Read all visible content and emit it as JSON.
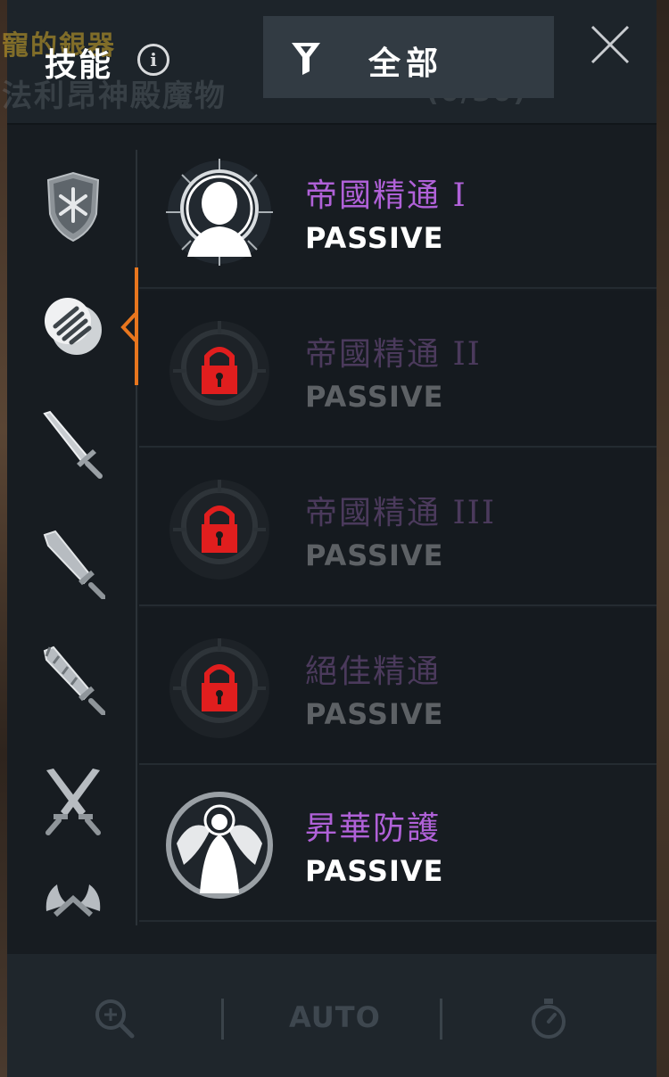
{
  "header": {
    "title": "技能",
    "info_icon": "info-icon",
    "filter_label": "全部",
    "filter_icon": "filter-icon",
    "close_icon": "close-icon",
    "background_ghost_text": [
      "寵的銀器",
      "法利昂神殿魔物",
      "(0/30)"
    ]
  },
  "sidebar": {
    "active_index": 1,
    "items": [
      {
        "icon": "shield-icon"
      },
      {
        "icon": "passive-orb-icon"
      },
      {
        "icon": "sword-icon"
      },
      {
        "icon": "broadsword-icon"
      },
      {
        "icon": "serrated-sword-icon"
      },
      {
        "icon": "crossed-swords-icon"
      },
      {
        "icon": "axes-icon"
      }
    ]
  },
  "skills": [
    {
      "name": "帝國精通 I",
      "type": "PASSIVE",
      "locked": false,
      "icon": "radiant-head-icon"
    },
    {
      "name": "帝國精通 II",
      "type": "PASSIVE",
      "locked": true,
      "icon": "lock-icon"
    },
    {
      "name": "帝國精通 III",
      "type": "PASSIVE",
      "locked": true,
      "icon": "lock-icon"
    },
    {
      "name": "絕佳精通",
      "type": "PASSIVE",
      "locked": true,
      "icon": "lock-icon"
    },
    {
      "name": "昇華防護",
      "type": "PASSIVE",
      "locked": false,
      "icon": "winged-figure-icon"
    }
  ],
  "bottom_bar": {
    "zoom_icon": "zoom-in-icon",
    "auto_label": "AUTO",
    "timer_icon": "stopwatch-icon"
  },
  "colors": {
    "panel_bg": "#171c21",
    "skill_name": "#b061d8",
    "accent": "#e8761e",
    "lock": "#e01e1e"
  }
}
